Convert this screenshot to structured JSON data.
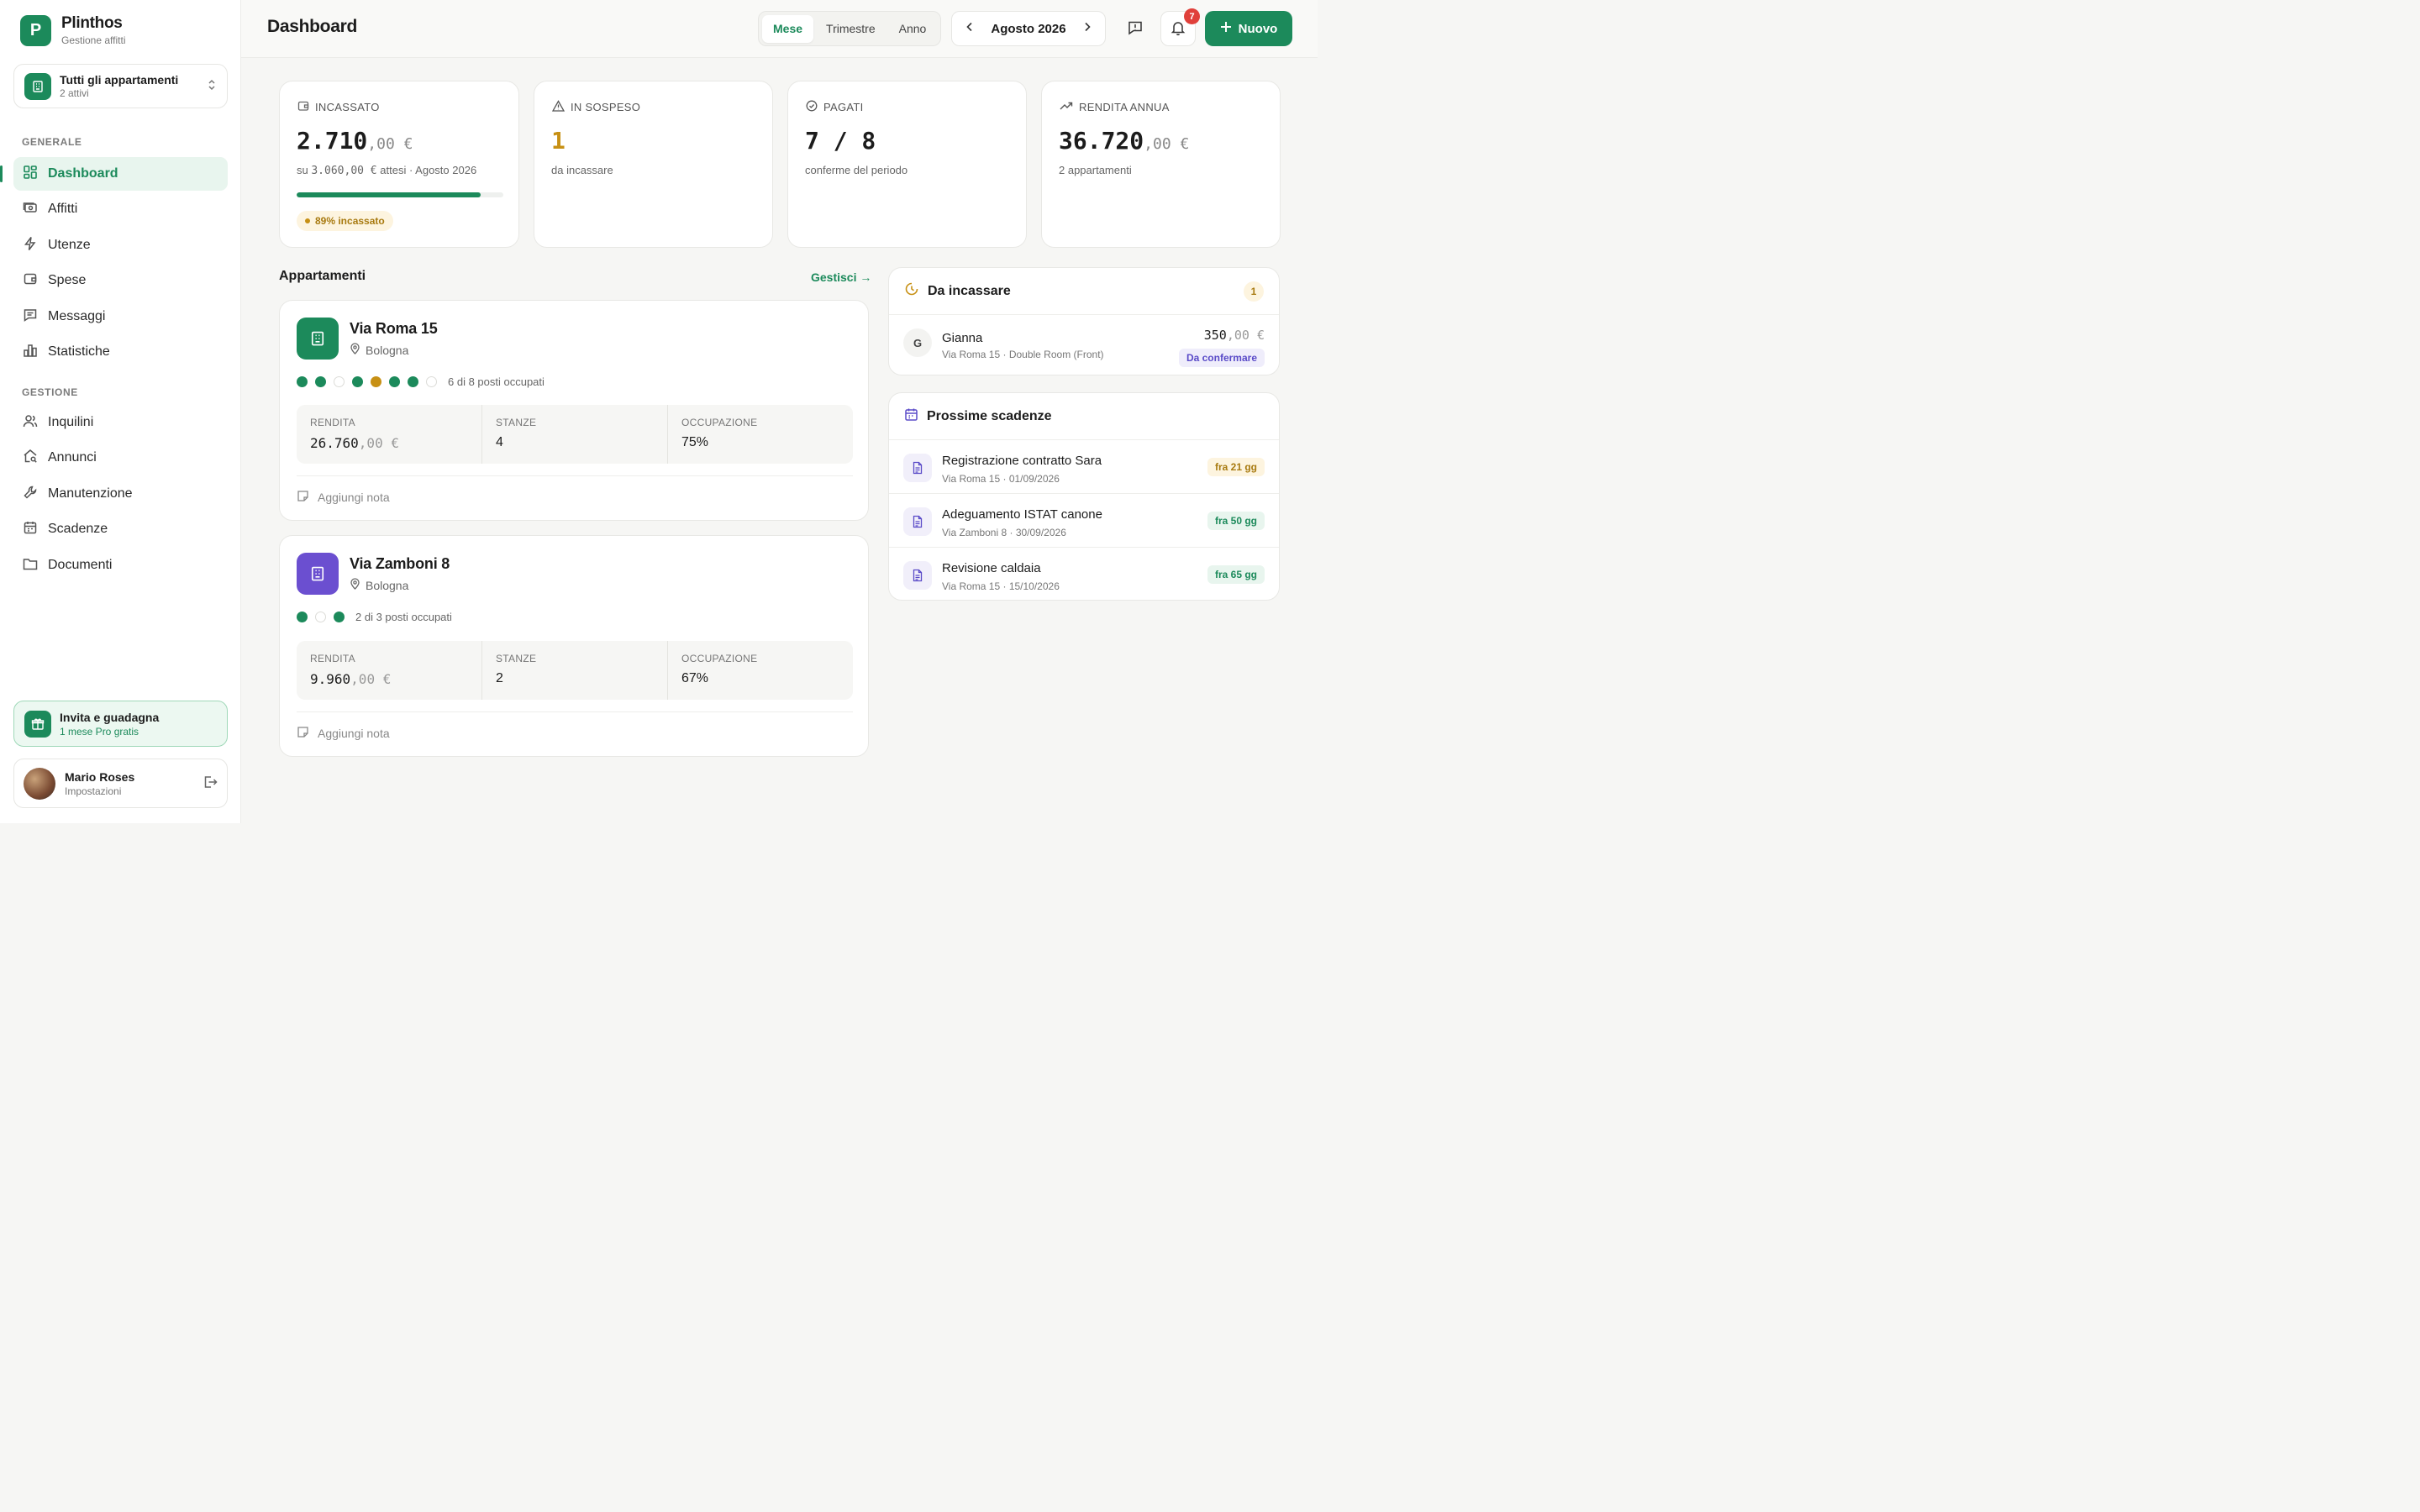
{
  "brand": {
    "logo_letter": "P",
    "name": "Plinthos",
    "subtitle": "Gestione affitti"
  },
  "apartment_selector": {
    "label": "Tutti gli appartamenti",
    "sub": "2 attivi"
  },
  "nav": {
    "section_general": "GENERALE",
    "section_manage": "GESTIONE",
    "general": [
      {
        "label": "Dashboard",
        "icon": "grid-icon",
        "active": true
      },
      {
        "label": "Affitti",
        "icon": "money-icon"
      },
      {
        "label": "Utenze",
        "icon": "bolt-icon"
      },
      {
        "label": "Spese",
        "icon": "wallet-icon"
      },
      {
        "label": "Messaggi",
        "icon": "message-icon"
      },
      {
        "label": "Statistiche",
        "icon": "bar-chart-icon"
      }
    ],
    "manage": [
      {
        "label": "Inquilini",
        "icon": "users-icon"
      },
      {
        "label": "Annunci",
        "icon": "house-search-icon"
      },
      {
        "label": "Manutenzione",
        "icon": "wrench-icon"
      },
      {
        "label": "Scadenze",
        "icon": "calendar-icon"
      },
      {
        "label": "Documenti",
        "icon": "folder-icon"
      }
    ]
  },
  "invite": {
    "title": "Invita e guadagna",
    "sub": "1 mese Pro gratis"
  },
  "user": {
    "name": "Mario Roses",
    "sub": "Impostazioni"
  },
  "topbar": {
    "title": "Dashboard",
    "segments": [
      "Mese",
      "Trimestre",
      "Anno"
    ],
    "active_segment": "Mese",
    "period": "Agosto 2026",
    "notification_count": "7",
    "new_button": "Nuovo"
  },
  "stats": {
    "incassato": {
      "label": "INCASSATO",
      "value": "2.710",
      "decimals": ",00 €",
      "sub_prefix": "su",
      "sub_amount": "3.060,00 €",
      "sub_suffix": "attesi · Agosto 2026",
      "progress_percent": 89,
      "pill": "89% incassato"
    },
    "sospeso": {
      "label": "IN SOSPESO",
      "value": "1",
      "sub": "da incassare"
    },
    "pagati": {
      "label": "PAGATI",
      "value": "7 / 8",
      "sub": "conferme del periodo"
    },
    "rendita": {
      "label": "RENDITA ANNUA",
      "value": "36.720",
      "decimals": ",00 €",
      "sub": "2 appartamenti"
    }
  },
  "apartments": {
    "heading": "Appartamenti",
    "manage_link": "Gestisci →",
    "items": [
      {
        "name": "Via Roma 15",
        "city": "Bologna",
        "color": "#1c8a5b",
        "occupancy_dots": [
          "g",
          "g",
          "e",
          "g",
          "a",
          "g",
          "g",
          "e"
        ],
        "occupancy_text": "6 di 8 posti occupati",
        "kpi_labels": [
          "RENDITA",
          "STANZE",
          "OCCUPAZIONE"
        ],
        "rendita": "26.760",
        "rendita_dec": ",00 €",
        "stanze": "4",
        "occupazione": "75%",
        "note": "Aggiungi nota"
      },
      {
        "name": "Via Zamboni 8",
        "city": "Bologna",
        "color": "#6b4fd0",
        "occupancy_dots": [
          "g",
          "e",
          "g"
        ],
        "occupancy_text": "2 di 3 posti occupati",
        "kpi_labels": [
          "RENDITA",
          "STANZE",
          "OCCUPAZIONE"
        ],
        "rendita": "9.960",
        "rendita_dec": ",00 €",
        "stanze": "2",
        "occupazione": "67%",
        "note": "Aggiungi nota"
      }
    ]
  },
  "da_incassare": {
    "title": "Da incassare",
    "count": "1",
    "items": [
      {
        "initial": "G",
        "name": "Gianna",
        "detail": "Via Roma 15 · Double Room (Front)",
        "amount": "350",
        "amount_dec": ",00 €",
        "status": "Da confermare"
      }
    ]
  },
  "scadenze": {
    "title": "Prossime scadenze",
    "items": [
      {
        "title": "Registrazione contratto Sara",
        "detail": "Via Roma 15 · 01/09/2026",
        "due": "fra 21 gg",
        "tone": "amber"
      },
      {
        "title": "Adeguamento ISTAT canone",
        "detail": "Via Zamboni 8 · 30/09/2026",
        "due": "fra 50 gg",
        "tone": "green"
      },
      {
        "title": "Revisione caldaia",
        "detail": "Via Roma 15 · 15/10/2026",
        "due": "fra 65 gg",
        "tone": "green"
      }
    ]
  }
}
